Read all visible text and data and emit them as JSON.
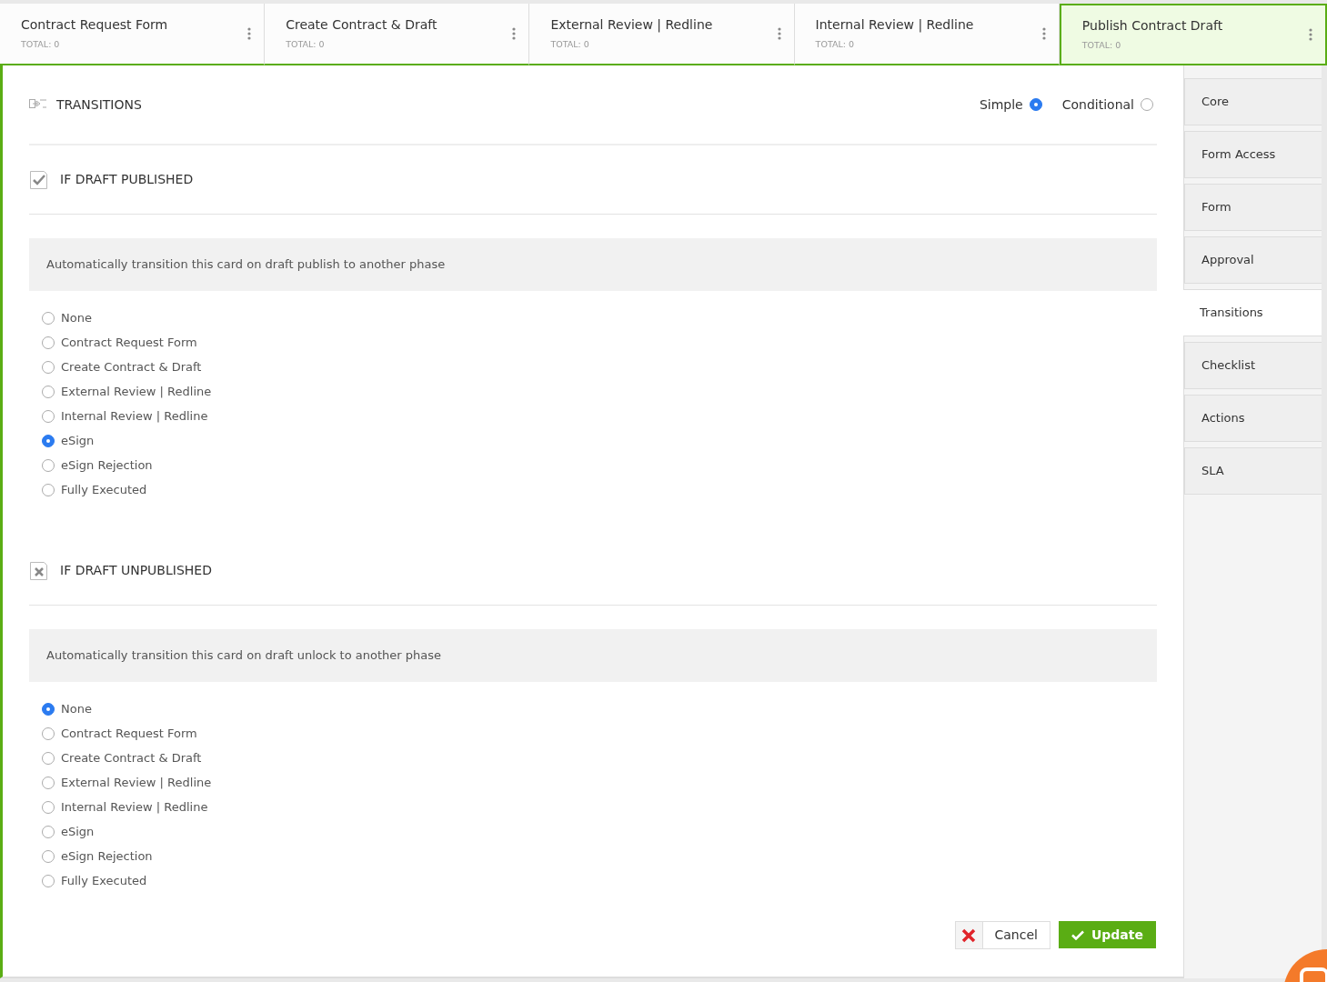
{
  "phases": [
    {
      "title": "Contract Request Form",
      "total": "TOTAL: 0",
      "selected": false
    },
    {
      "title": "Create Contract & Draft",
      "total": "TOTAL: 0",
      "selected": false
    },
    {
      "title": "External Review | Redline",
      "total": "TOTAL: 0",
      "selected": false
    },
    {
      "title": "Internal Review | Redline",
      "total": "TOTAL: 0",
      "selected": false
    },
    {
      "title": "Publish Contract Draft",
      "total": "TOTAL: 0",
      "selected": true
    }
  ],
  "transitions": {
    "title": "TRANSITIONS",
    "modes": [
      {
        "label": "Simple",
        "selected": true
      },
      {
        "label": "Conditional",
        "selected": false
      }
    ]
  },
  "sections": [
    {
      "kind": "published",
      "title": "IF DRAFT PUBLISHED",
      "description": "Automatically transition this card on draft publish to another phase",
      "options": [
        {
          "label": "None",
          "selected": false
        },
        {
          "label": "Contract Request Form",
          "selected": false
        },
        {
          "label": "Create Contract & Draft",
          "selected": false
        },
        {
          "label": "External Review | Redline",
          "selected": false
        },
        {
          "label": "Internal Review | Redline",
          "selected": false
        },
        {
          "label": "eSign",
          "selected": true
        },
        {
          "label": "eSign Rejection",
          "selected": false
        },
        {
          "label": "Fully Executed",
          "selected": false
        }
      ]
    },
    {
      "kind": "unpublished",
      "title": "IF DRAFT UNPUBLISHED",
      "description": "Automatically transition this card on draft unlock to another phase",
      "options": [
        {
          "label": "None",
          "selected": true
        },
        {
          "label": "Contract Request Form",
          "selected": false
        },
        {
          "label": "Create Contract & Draft",
          "selected": false
        },
        {
          "label": "External Review | Redline",
          "selected": false
        },
        {
          "label": "Internal Review | Redline",
          "selected": false
        },
        {
          "label": "eSign",
          "selected": false
        },
        {
          "label": "eSign Rejection",
          "selected": false
        },
        {
          "label": "Fully Executed",
          "selected": false
        }
      ]
    }
  ],
  "sidebar": [
    {
      "label": "Core",
      "selected": false
    },
    {
      "label": "Form Access",
      "selected": false
    },
    {
      "label": "Form",
      "selected": false
    },
    {
      "label": "Approval",
      "selected": false
    },
    {
      "label": "Transitions",
      "selected": true
    },
    {
      "label": "Checklist",
      "selected": false
    },
    {
      "label": "Actions",
      "selected": false
    },
    {
      "label": "SLA",
      "selected": false
    }
  ],
  "buttons": {
    "cancel": "Cancel",
    "update": "Update"
  }
}
